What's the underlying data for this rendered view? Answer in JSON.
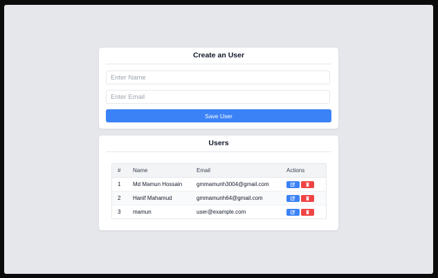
{
  "create_form": {
    "title": "Create an User",
    "name_placeholder": "Enter Name",
    "email_placeholder": "Enter Email",
    "save_label": "Save User"
  },
  "users_table": {
    "title": "Users",
    "columns": [
      "#",
      "Name",
      "Email",
      "Actions"
    ],
    "rows": [
      {
        "num": "1",
        "name": "Md Mamun Hossain",
        "email": "gmmamunh3004@gmail.com"
      },
      {
        "num": "2",
        "name": "Hanif Mahamud",
        "email": "gmmamunh64@gmail.com"
      },
      {
        "num": "3",
        "name": "mamun",
        "email": "user@example.com"
      }
    ],
    "action_icons": {
      "edit": "edit-icon",
      "delete": "trash-icon"
    }
  },
  "colors": {
    "primary": "#3b82f6",
    "danger": "#ef4444",
    "page_background": "#e5e7eb"
  }
}
